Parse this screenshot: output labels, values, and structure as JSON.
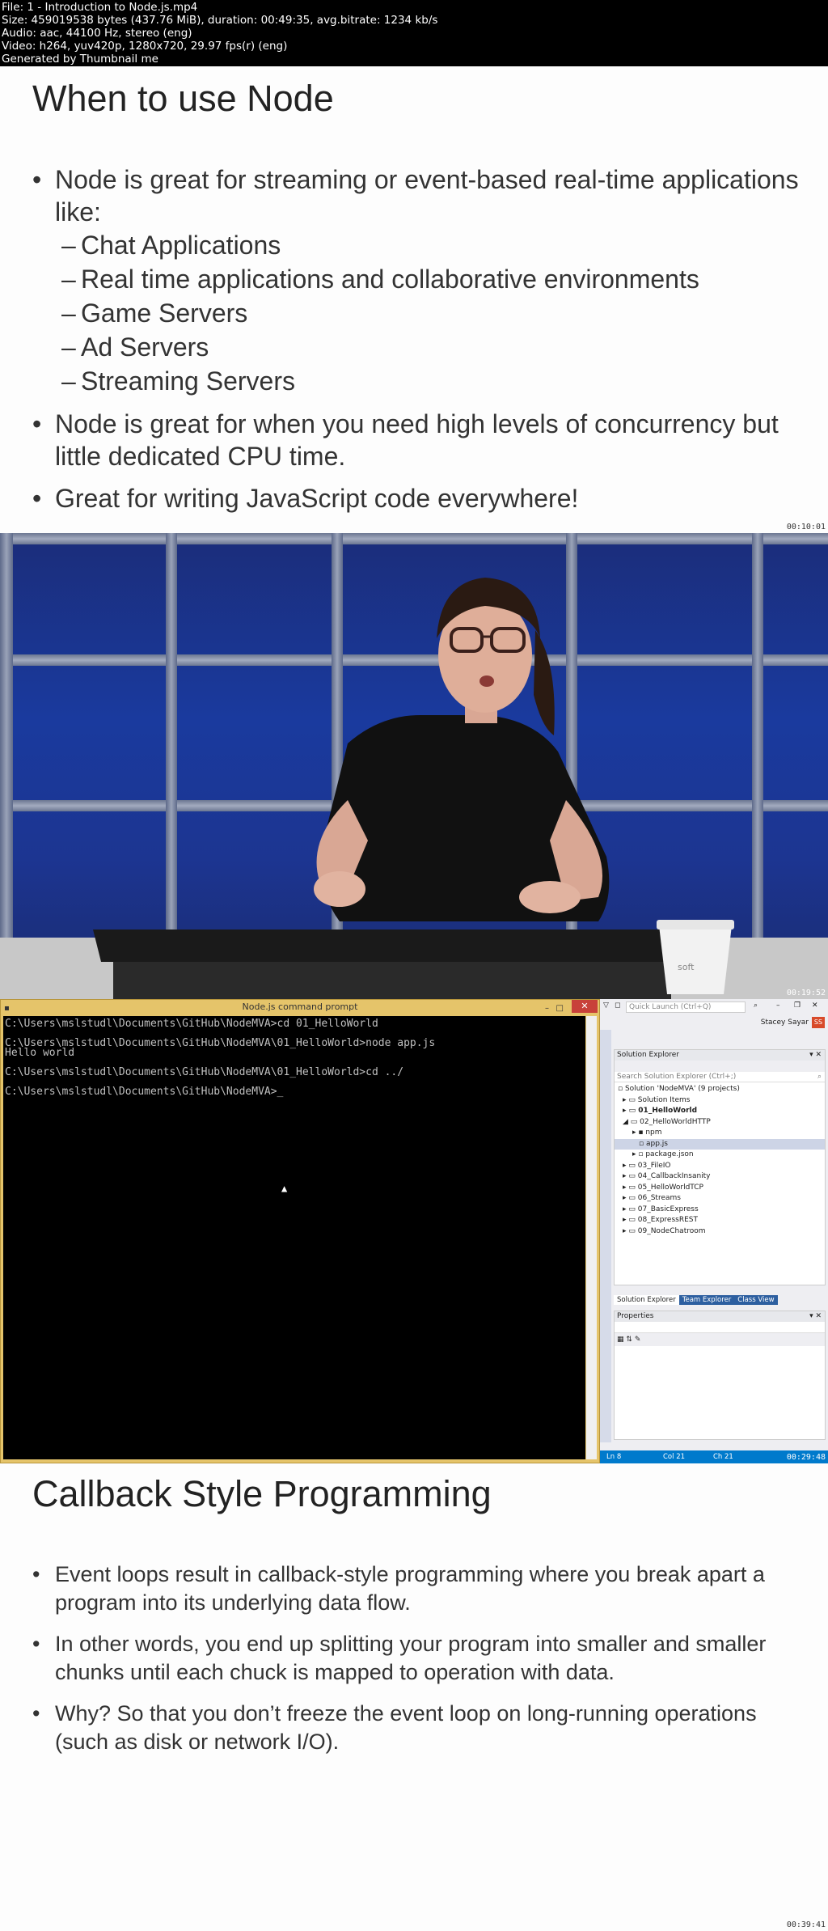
{
  "meta": {
    "lines": [
      "File: 1 - Introduction to Node.js.mp4",
      "Size: 459019538 bytes (437.76 MiB), duration: 00:49:35, avg.bitrate: 1234 kb/s",
      "Audio: aac, 44100 Hz, stereo (eng)",
      "Video: h264, yuv420p, 1280x720, 29.97 fps(r) (eng)",
      "Generated by Thumbnail me"
    ]
  },
  "slide1": {
    "title": "When to use Node",
    "bullet1": {
      "text": "Node is great for streaming or event-based real-time applications like:",
      "subs": [
        "Chat Applications",
        "Real time applications and collaborative environments",
        "Game Servers",
        "Ad Servers",
        "Streaming Servers"
      ]
    },
    "bullet2": "Node is great for when you need high levels of concurrency but little dedicated CPU time.",
    "bullet3": "Great for writing JavaScript code everywhere!",
    "timestamp": "00:10:01"
  },
  "video": {
    "timestamp": "00:19:52",
    "cup_text": "soft"
  },
  "desktop": {
    "timestamp": "00:29:48",
    "cmd_title": "Node.js command prompt",
    "cmd_lines": [
      "C:\\Users\\mslstudl\\Documents\\GitHub\\NodeMVA>cd 01_HelloWorld",
      "",
      "C:\\Users\\mslstudl\\Documents\\GitHub\\NodeMVA\\01_HelloWorld>node app.js",
      "Hello world",
      "",
      "C:\\Users\\mslstudl\\Documents\\GitHub\\NodeMVA\\01_HelloWorld>cd ../",
      "",
      "C:\\Users\\mslstudl\\Documents\\GitHub\\NodeMVA>_"
    ],
    "vs": {
      "quick_launch": "Quick Launch (Ctrl+Q)",
      "user": "Stacey Sayar",
      "badge": "SS",
      "se_title": "Solution Explorer",
      "se_search": "Search Solution Explorer (Ctrl+;)",
      "tree": [
        "Solution 'NodeMVA' (9 projects)",
        "Solution Items",
        "01_HelloWorld",
        "02_HelloWorldHTTP",
        "npm",
        "app.js",
        "package.json",
        "03_FileIO",
        "04_CallbackInsanity",
        "05_HelloWorldTCP",
        "06_Streams",
        "07_BasicExpress",
        "08_ExpressREST",
        "09_NodeChatroom"
      ],
      "tabs": [
        "Solution Explorer",
        "Team Explorer",
        "Class View"
      ],
      "props_title": "Properties",
      "status": {
        "ln": "Ln 8",
        "col": "Col 21",
        "ch": "Ch 21"
      }
    }
  },
  "slide3": {
    "title": "Callback Style Programming",
    "bullets": [
      "Event loops result in callback-style programming where you break apart a program into its underlying data flow.",
      "In other words, you end up splitting your program into smaller and smaller chunks until each chuck is mapped to operation with data.",
      "Why? So that you don’t freeze the event loop on long-running operations (such as disk or network I/O)."
    ],
    "timestamp": "00:39:41"
  }
}
